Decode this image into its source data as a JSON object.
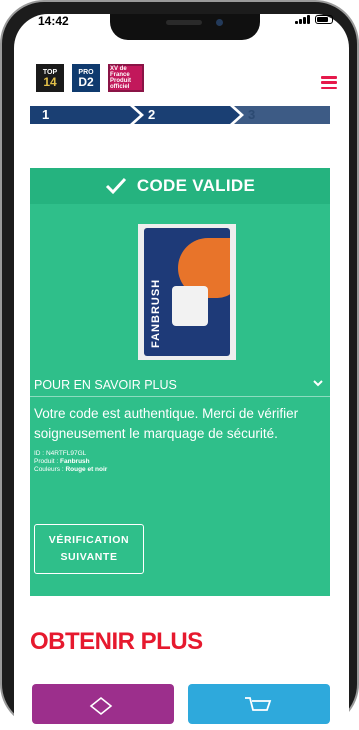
{
  "status_bar": {
    "time": "14:42"
  },
  "header": {
    "logos": [
      {
        "name": "top14-logo",
        "line1": "TOP",
        "line2": "14"
      },
      {
        "name": "prod2-logo",
        "line1": "PRO",
        "line2": "D2"
      },
      {
        "name": "xv-france-logo",
        "line1": "XV de France",
        "line2": "Produit officiel"
      }
    ]
  },
  "steps": [
    "1",
    "2",
    "3"
  ],
  "result": {
    "title": "CODE VALIDE",
    "product_brand": "FANBRUSH",
    "more_info_label": "POUR EN SAVOIR PLUS",
    "message": "Votre code est authentique. Merci de vérifier soigneusement le marquage de sécurité.",
    "id_label": "ID :",
    "id_value": "N4RTFL97GL",
    "product_label": "Produit :",
    "product_value": "Fanbrush",
    "colors_label": "Couleurs :",
    "colors_value": "Rouge et noir",
    "next_button_line1": "VÉRIFICATION",
    "next_button_line2": "SUIVANTE"
  },
  "get_more": {
    "title": "OBTENIR PLUS"
  },
  "colors": {
    "green": "#2fbf8a",
    "navy": "#1a3f73",
    "red": "#e6192e",
    "purple": "#9c2f8c",
    "blue": "#2ea9dc"
  },
  "icons": [
    "check-icon",
    "chevron-down-icon",
    "hamburger-menu-icon",
    "gift-icon",
    "cart-icon"
  ]
}
